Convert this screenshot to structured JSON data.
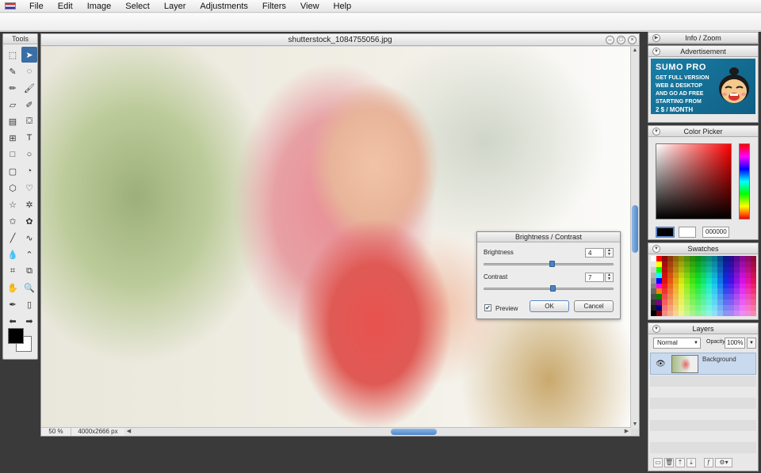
{
  "menubar": {
    "items": [
      "File",
      "Edit",
      "Image",
      "Select",
      "Layer",
      "Adjustments",
      "Filters",
      "View",
      "Help"
    ]
  },
  "tools_panel": {
    "title": "Tools",
    "tools": [
      {
        "icon": "rect-marquee-icon",
        "glyph": "⬚",
        "active": false
      },
      {
        "icon": "move-arrow-icon",
        "glyph": "➤",
        "active": true
      },
      {
        "icon": "magic-wand-icon",
        "glyph": "✎",
        "active": false
      },
      {
        "icon": "lasso-icon",
        "glyph": "◌",
        "active": false
      },
      {
        "icon": "pencil-icon",
        "glyph": "✏",
        "active": false
      },
      {
        "icon": "brush-icon",
        "glyph": "🖌",
        "active": false
      },
      {
        "icon": "eraser-icon",
        "glyph": "▱",
        "active": false
      },
      {
        "icon": "smudge-icon",
        "glyph": "✐",
        "active": false
      },
      {
        "icon": "gradient-icon",
        "glyph": "▤",
        "active": false
      },
      {
        "icon": "paint-bucket-icon",
        "glyph": "⛋",
        "active": false
      },
      {
        "icon": "stamp-icon",
        "glyph": "⊞",
        "active": false
      },
      {
        "icon": "text-icon",
        "glyph": "T",
        "active": false
      },
      {
        "icon": "rectangle-shape-icon",
        "glyph": "□",
        "active": false
      },
      {
        "icon": "ellipse-shape-icon",
        "glyph": "○",
        "active": false
      },
      {
        "icon": "rounded-rect-icon",
        "glyph": "▢",
        "active": false
      },
      {
        "icon": "speech-shape-icon",
        "glyph": "◔",
        "active": false
      },
      {
        "icon": "hexagon-shape-icon",
        "glyph": "⬡",
        "active": false
      },
      {
        "icon": "heart-shape-icon",
        "glyph": "♡",
        "active": false
      },
      {
        "icon": "star-shape-icon",
        "glyph": "☆",
        "active": false
      },
      {
        "icon": "starburst-shape-icon",
        "glyph": "✲",
        "active": false
      },
      {
        "icon": "star-outline-icon",
        "glyph": "✩",
        "active": false
      },
      {
        "icon": "flower-shape-icon",
        "glyph": "✿",
        "active": false
      },
      {
        "icon": "line-tool-icon",
        "glyph": "╱",
        "active": false
      },
      {
        "icon": "curve-tool-icon",
        "glyph": "∿",
        "active": false
      },
      {
        "icon": "blur-drop-icon",
        "glyph": "💧",
        "active": false
      },
      {
        "icon": "sharpen-icon",
        "glyph": "⌃",
        "active": false
      },
      {
        "icon": "crop-icon",
        "glyph": "⌗",
        "active": false
      },
      {
        "icon": "transform-icon",
        "glyph": "⧉",
        "active": false
      },
      {
        "icon": "hand-pan-icon",
        "glyph": "✋",
        "active": false
      },
      {
        "icon": "zoom-icon",
        "glyph": "🔍",
        "active": false
      },
      {
        "icon": "eyedropper-icon",
        "glyph": "✒",
        "active": false
      },
      {
        "icon": "fill-tube-icon",
        "glyph": "▯",
        "active": false
      },
      {
        "icon": "undo-arrow-icon",
        "glyph": "⬅",
        "active": false
      },
      {
        "icon": "redo-arrow-icon",
        "glyph": "➡",
        "active": false
      }
    ]
  },
  "document": {
    "title": "shutterstock_1084755056.jpg",
    "zoom": "50 %",
    "dimensions": "4000x2666 px"
  },
  "brightness_contrast": {
    "title": "Brightness / Contrast",
    "brightness_label": "Brightness",
    "brightness_value": "4",
    "brightness_fraction": 0.52,
    "contrast_label": "Contrast",
    "contrast_value": "7",
    "contrast_fraction": 0.53,
    "preview_label": "Preview",
    "preview_checked": true,
    "ok_label": "OK",
    "cancel_label": "Cancel"
  },
  "panels": {
    "info_zoom_title": "Info / Zoom",
    "advertisement_title": "Advertisement",
    "ad": {
      "headline": "SUMO PRO",
      "lines": [
        "GET FULL VERSION",
        "WEB & DESKTOP",
        "AND GO AD FREE",
        "STARTING FROM",
        "2 $ / MONTH"
      ]
    },
    "color_picker_title": "Color Picker",
    "color_picker_hex": "000000",
    "swatches_title": "Swatches",
    "layers": {
      "title": "Layers",
      "blend_mode": "Normal",
      "opacity_label": "Opacity:",
      "opacity_value": "100%",
      "layer_name": "Background"
    }
  },
  "colors": {
    "accent": "#4e86c8",
    "foreground": "#000000",
    "background": "#ffffff"
  }
}
